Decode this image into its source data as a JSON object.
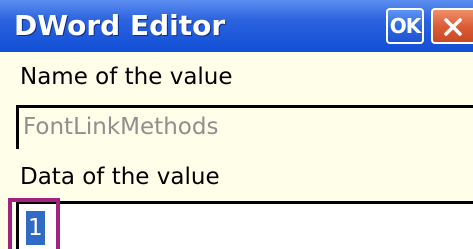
{
  "window": {
    "title": "DWord Editor",
    "ok_label": "OK",
    "close_icon": "close-icon",
    "colors": {
      "titlebar": "#2c63df",
      "close_button": "#db5a34",
      "background": "#fffee8",
      "selection": "#316ac5",
      "highlight": "#a0247f"
    }
  },
  "form": {
    "name_label": "Name of the value",
    "name_value": "FontLinkMethods",
    "data_label": "Data of the value",
    "data_value": "1"
  }
}
